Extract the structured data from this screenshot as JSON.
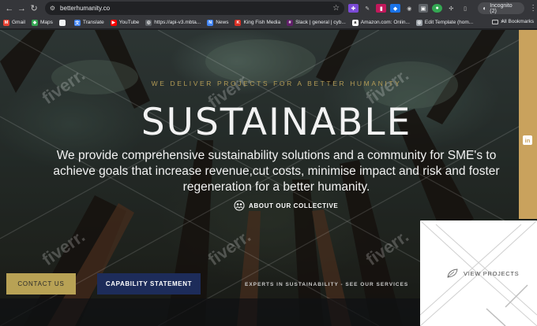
{
  "browser": {
    "url": "betterhumanity.co",
    "profile_label": "Incognito (2)",
    "icons": [
      "back-icon",
      "forward-icon",
      "reload-icon",
      "tune-icon",
      "star-icon",
      "kebab-menu-icon"
    ]
  },
  "bookmarks": {
    "items": [
      {
        "label": "Gmail",
        "icon": "gmail-icon",
        "color": "#ea4335",
        "glyph": "M"
      },
      {
        "label": "Maps",
        "icon": "maps-icon",
        "color": "#34a853",
        "glyph": "◆"
      },
      {
        "label": "",
        "icon": "blank-page-icon",
        "color": "#f1f3f4",
        "glyph": ""
      },
      {
        "label": "Translate",
        "icon": "translate-icon",
        "color": "#4285f4",
        "glyph": "文"
      },
      {
        "label": "YouTube",
        "icon": "youtube-icon",
        "color": "#ff0000",
        "glyph": "▶"
      },
      {
        "label": "https://api-v3.mbta...",
        "icon": "globe-icon",
        "color": "#5f6368",
        "glyph": "◎"
      },
      {
        "label": "News",
        "icon": "news-icon",
        "color": "#4285f4",
        "glyph": "N"
      },
      {
        "label": "King Fish Media",
        "icon": "kingfish-icon",
        "color": "#d93025",
        "glyph": "K"
      },
      {
        "label": "Slack | general | cyb...",
        "icon": "slack-icon",
        "color": "#611f69",
        "glyph": "#"
      },
      {
        "label": "Amazon.com: Onlin...",
        "icon": "amazon-icon",
        "color": "#ffffff",
        "glyph": "a"
      },
      {
        "label": "Edit Template (hom...",
        "icon": "edit-template-icon",
        "color": "#9aa0a6",
        "glyph": "◎"
      }
    ],
    "all_bookmarks_label": "All Bookmarks"
  },
  "site": {
    "tagline": "WE DELIVER PROJECTS FOR A BETTER HUMANITY",
    "headline": "SUSTAINABLE",
    "subtitle": "We provide comprehensive sustainability solutions and a community for SME's to achieve goals that increase revenue,cut costs, minimise impact and risk and foster regeneration for a better humanity.",
    "collective_link": "ABOUT OUR COLLECTIVE",
    "linkedin_label": "in",
    "projects_label": "VIEW PROJECTS",
    "contact_button": "CONTACT US",
    "capability_button": "CAPABILITY STATEMENT",
    "experts_text": "EXPERTS IN SUSTAINABILITY - SEE OUR SERVICES",
    "watermark": "fiverr."
  },
  "colors": {
    "accent_gold": "#c9a25d",
    "contact_bg": "#b8a255",
    "capability_bg": "#1d2c5a",
    "tagline": "#b29a55"
  }
}
